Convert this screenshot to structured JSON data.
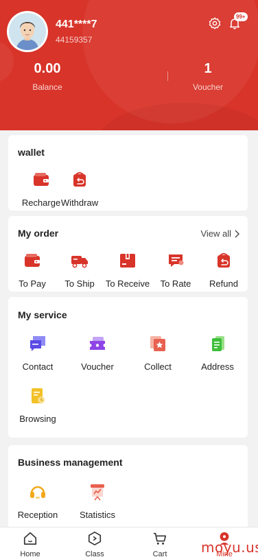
{
  "profile": {
    "username": "441****7",
    "user_id": "44159357",
    "notification_badge": "99+"
  },
  "stats": [
    {
      "value": "0.00",
      "label": "Balance"
    },
    {
      "value": "1",
      "label": "Voucher"
    }
  ],
  "wallet": {
    "title": "wallet",
    "items": [
      {
        "label": "Recharge",
        "icon": "wallet-icon"
      },
      {
        "label": "Withdraw",
        "icon": "withdraw-icon"
      }
    ]
  },
  "order": {
    "title": "My order",
    "view_all": "View all",
    "items": [
      {
        "label": "To Pay",
        "icon": "wallet-icon"
      },
      {
        "label": "To Ship",
        "icon": "truck-icon"
      },
      {
        "label": "To Receive",
        "icon": "box-icon"
      },
      {
        "label": "To Rate",
        "icon": "comment-icon"
      },
      {
        "label": "Refund",
        "icon": "refund-icon"
      }
    ]
  },
  "service": {
    "title": "My service",
    "items": [
      {
        "label": "Contact",
        "icon": "chat-icon"
      },
      {
        "label": "Voucher",
        "icon": "ticket-icon"
      },
      {
        "label": "Collect",
        "icon": "star-icon"
      },
      {
        "label": "Address",
        "icon": "document-icon"
      },
      {
        "label": "Browsing",
        "icon": "history-icon"
      }
    ]
  },
  "business": {
    "title": "Business management",
    "items": [
      {
        "label": "Reception",
        "icon": "headset-icon"
      },
      {
        "label": "Statistics",
        "icon": "chart-icon"
      }
    ]
  },
  "tabbar": [
    {
      "label": "Home",
      "icon": "home-icon"
    },
    {
      "label": "Class",
      "icon": "compass-icon"
    },
    {
      "label": "Cart",
      "icon": "cart-icon"
    },
    {
      "label": "Mine",
      "icon": "user-icon"
    }
  ],
  "watermark": "moyu.us",
  "colors": {
    "brand_red": "#d8342a",
    "background": "#f2f2f2"
  }
}
